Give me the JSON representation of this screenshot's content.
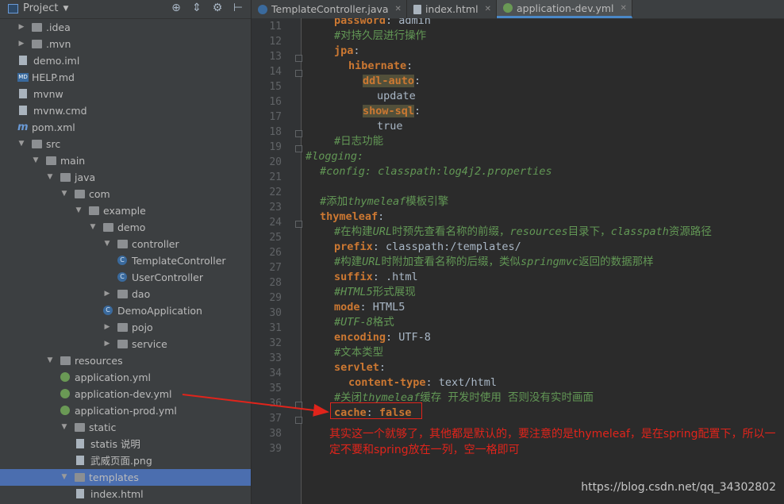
{
  "panel": {
    "title": "Project"
  },
  "tree": [
    {
      "label": ".idea",
      "icon": "folder",
      "arrow": "right",
      "depth": 0
    },
    {
      "label": ".mvn",
      "icon": "folder",
      "arrow": "right",
      "depth": 0
    },
    {
      "label": "demo.iml",
      "icon": "file",
      "depth": 0
    },
    {
      "label": "HELP.md",
      "icon": "md",
      "depth": 0
    },
    {
      "label": "mvnw",
      "icon": "file",
      "depth": 0
    },
    {
      "label": "mvnw.cmd",
      "icon": "file",
      "depth": 0
    },
    {
      "label": "pom.xml",
      "icon": "maven",
      "depth": 0
    },
    {
      "label": "src",
      "icon": "folder",
      "arrow": "down",
      "depth": 0
    },
    {
      "label": "main",
      "icon": "folder",
      "arrow": "down",
      "depth": 1
    },
    {
      "label": "java",
      "icon": "folder-src",
      "arrow": "down",
      "depth": 2
    },
    {
      "label": "com",
      "icon": "package",
      "arrow": "down",
      "depth": 3
    },
    {
      "label": "example",
      "icon": "package",
      "arrow": "down",
      "depth": 4
    },
    {
      "label": "demo",
      "icon": "package",
      "arrow": "down",
      "depth": 5
    },
    {
      "label": "controller",
      "icon": "package",
      "arrow": "down",
      "depth": 6
    },
    {
      "label": "TemplateController",
      "icon": "class",
      "depth": 7
    },
    {
      "label": "UserController",
      "icon": "class",
      "depth": 7
    },
    {
      "label": "dao",
      "icon": "package",
      "arrow": "right",
      "depth": 6
    },
    {
      "label": "DemoApplication",
      "icon": "spring-class",
      "depth": 6
    },
    {
      "label": "pojo",
      "icon": "package",
      "arrow": "right",
      "depth": 6
    },
    {
      "label": "service",
      "icon": "package",
      "arrow": "right",
      "depth": 6
    },
    {
      "label": "resources",
      "icon": "folder-res",
      "arrow": "down",
      "depth": 2
    },
    {
      "label": "application.yml",
      "icon": "yml",
      "depth": 3
    },
    {
      "label": "application-dev.yml",
      "icon": "yml",
      "depth": 3
    },
    {
      "label": "application-prod.yml",
      "icon": "yml",
      "depth": 3
    },
    {
      "label": "static",
      "icon": "folder",
      "arrow": "down",
      "depth": 3
    },
    {
      "label": "statis 说明",
      "icon": "file",
      "depth": 4
    },
    {
      "label": "武威页面.png",
      "icon": "file",
      "depth": 4
    },
    {
      "label": "templates",
      "icon": "folder",
      "arrow": "down",
      "depth": 3,
      "selected": true
    },
    {
      "label": "index.html",
      "icon": "file",
      "depth": 4
    }
  ],
  "tabs": [
    {
      "label": "TemplateController.java",
      "icon": "class",
      "active": false
    },
    {
      "label": "index.html",
      "icon": "file",
      "active": false
    },
    {
      "label": "application-dev.yml",
      "icon": "yml",
      "active": true
    }
  ],
  "editor": {
    "first_line": 11,
    "line_numbers": [
      "11",
      "12",
      "13",
      "14",
      "15",
      "16",
      "17",
      "18",
      "19",
      "20",
      "21",
      "22",
      "23",
      "24",
      "25",
      "26",
      "27",
      "28",
      "29",
      "30",
      "31",
      "32",
      "33",
      "34",
      "35",
      "36",
      "37",
      "38",
      "39"
    ],
    "lines": [
      {
        "indent": 2,
        "parts": [
          {
            "t": "password",
            "c": "key"
          },
          {
            "t": ": admin",
            "c": "val"
          }
        ]
      },
      {
        "indent": 2,
        "parts": [
          {
            "t": "#对持久层进行操作",
            "c": "cmtn"
          }
        ]
      },
      {
        "indent": 2,
        "parts": [
          {
            "t": "jpa",
            "c": "key"
          },
          {
            "t": ":",
            "c": "val"
          }
        ]
      },
      {
        "indent": 3,
        "parts": [
          {
            "t": "hibernate",
            "c": "key"
          },
          {
            "t": ":",
            "c": "val"
          }
        ]
      },
      {
        "indent": 4,
        "parts": [
          {
            "t": "ddl-auto",
            "c": "hlk"
          },
          {
            "t": ":",
            "c": "val"
          }
        ]
      },
      {
        "indent": 5,
        "parts": [
          {
            "t": "update",
            "c": "val"
          }
        ]
      },
      {
        "indent": 4,
        "parts": [
          {
            "t": "show-sql",
            "c": "hlk"
          },
          {
            "t": ":",
            "c": "val"
          }
        ]
      },
      {
        "indent": 5,
        "parts": [
          {
            "t": "true",
            "c": "val"
          }
        ]
      },
      {
        "indent": 2,
        "parts": [
          {
            "t": "#日志功能",
            "c": "cmtn"
          }
        ]
      },
      {
        "indent": 0,
        "parts": [
          {
            "t": "#logging:",
            "c": "cmt"
          }
        ]
      },
      {
        "indent": 1,
        "parts": [
          {
            "t": "#config: classpath:log4j2.properties",
            "c": "cmt"
          }
        ]
      },
      {
        "indent": 0,
        "parts": []
      },
      {
        "indent": 1,
        "parts": [
          {
            "t": "#添加",
            "c": "cmtn"
          },
          {
            "t": "thymeleaf",
            "c": "cmt"
          },
          {
            "t": "模板引擎",
            "c": "cmtn"
          }
        ]
      },
      {
        "indent": 1,
        "parts": [
          {
            "t": "thymeleaf",
            "c": "key"
          },
          {
            "t": ":",
            "c": "val"
          }
        ]
      },
      {
        "indent": 2,
        "parts": [
          {
            "t": "#在构建",
            "c": "cmtn"
          },
          {
            "t": "URL",
            "c": "cmt"
          },
          {
            "t": "时预先查看名称的前缀，",
            "c": "cmtn"
          },
          {
            "t": "resources",
            "c": "cmt"
          },
          {
            "t": "目录下，",
            "c": "cmtn"
          },
          {
            "t": "classpath",
            "c": "cmt"
          },
          {
            "t": "资源路径",
            "c": "cmtn"
          }
        ]
      },
      {
        "indent": 2,
        "parts": [
          {
            "t": "prefix",
            "c": "key"
          },
          {
            "t": ": classpath:/templates/",
            "c": "val"
          }
        ]
      },
      {
        "indent": 2,
        "parts": [
          {
            "t": "#构建",
            "c": "cmtn"
          },
          {
            "t": "URL",
            "c": "cmt"
          },
          {
            "t": "时附加查看名称的后缀，类似",
            "c": "cmtn"
          },
          {
            "t": "springmvc",
            "c": "cmt"
          },
          {
            "t": "返回的数据那样",
            "c": "cmtn"
          }
        ]
      },
      {
        "indent": 2,
        "parts": [
          {
            "t": "suffix",
            "c": "key"
          },
          {
            "t": ": .html",
            "c": "val"
          }
        ]
      },
      {
        "indent": 2,
        "parts": [
          {
            "t": "#HTML5",
            "c": "cmt"
          },
          {
            "t": "形式展现",
            "c": "cmtn"
          }
        ]
      },
      {
        "indent": 2,
        "parts": [
          {
            "t": "mode",
            "c": "key"
          },
          {
            "t": ": HTML5",
            "c": "val"
          }
        ]
      },
      {
        "indent": 2,
        "parts": [
          {
            "t": "#UTF-8",
            "c": "cmt"
          },
          {
            "t": "格式",
            "c": "cmtn"
          }
        ]
      },
      {
        "indent": 2,
        "parts": [
          {
            "t": "encoding",
            "c": "key"
          },
          {
            "t": ": UTF-8",
            "c": "val"
          }
        ]
      },
      {
        "indent": 2,
        "parts": [
          {
            "t": "#文本类型",
            "c": "cmtn"
          }
        ]
      },
      {
        "indent": 2,
        "parts": [
          {
            "t": "servlet",
            "c": "key"
          },
          {
            "t": ":",
            "c": "val"
          }
        ]
      },
      {
        "indent": 3,
        "parts": [
          {
            "t": "content-type",
            "c": "key"
          },
          {
            "t": ": text/html",
            "c": "val"
          }
        ]
      },
      {
        "indent": 2,
        "parts": [
          {
            "t": "#关闭",
            "c": "cmtn"
          },
          {
            "t": "thymeleaf",
            "c": "cmt"
          },
          {
            "t": "缓存 开发时使用 否则没有实时画面",
            "c": "cmtn"
          }
        ]
      },
      {
        "indent": 2,
        "parts": [
          {
            "t": "cache",
            "c": "key"
          },
          {
            "t": ": ",
            "c": "val"
          },
          {
            "t": "false",
            "c": "key"
          }
        ]
      },
      {
        "indent": 0,
        "parts": []
      },
      {
        "indent": 0,
        "parts": []
      }
    ]
  },
  "annotation": {
    "note": "其实这一个就够了，其他都是默认的，要注意的是thymeleaf，是在spring配置下，所以一定不要和spring放在一列，空一格即可",
    "color": "#e0241b"
  },
  "watermark": "https://blog.csdn.net/qq_34302802"
}
